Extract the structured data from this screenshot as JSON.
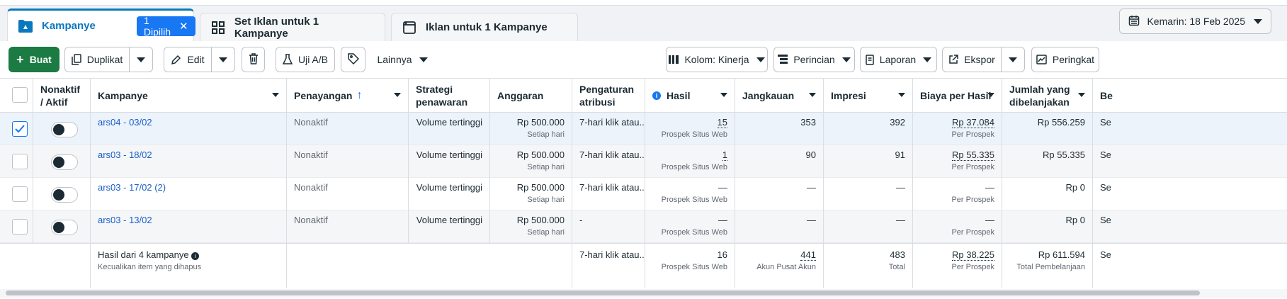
{
  "tabs": {
    "campaigns": {
      "label": "Kampanye",
      "selected_badge": "1 Dipilih"
    },
    "adsets": {
      "label": "Set Iklan untuk 1 Kampanye"
    },
    "ads": {
      "label": "Iklan untuk 1 Kampanye"
    }
  },
  "date_range": {
    "label": "Kemarin: 18 Feb 2025"
  },
  "toolbar": {
    "create": "Buat",
    "duplicate": "Duplikat",
    "edit": "Edit",
    "ab_test": "Uji A/B",
    "more": "Lainnya",
    "columns": "Kolom: Kinerja",
    "breakdown": "Perincian",
    "reports": "Laporan",
    "export": "Ekspor",
    "rules": "Peringkat"
  },
  "columns": {
    "onoff": "Nonaktif / Aktif",
    "campaign": "Kampanye",
    "delivery": "Penayangan",
    "bid_strategy": "Strategi penawaran",
    "budget": "Anggaran",
    "attribution": "Pengaturan atribusi",
    "results": "Hasil",
    "reach": "Jangkauan",
    "impressions": "Impresi",
    "cost_per_result": "Biaya per Hasil",
    "amount_spent": "Jumlah yang dibelanjakan",
    "next": "Be"
  },
  "rows": [
    {
      "name": "ars04 - 03/02",
      "delivery": "Nonaktif",
      "bid": "Volume tertinggi",
      "budget": "Rp 500.000",
      "budget_sub": "Setiap hari",
      "attribution": "7-hari klik atau...",
      "results": "15",
      "results_sub": "Prospek Situs Web",
      "reach": "353",
      "impressions": "392",
      "cpr": "Rp 37.084",
      "cpr_sub": "Per Prospek",
      "spent": "Rp 556.259",
      "next": "Se"
    },
    {
      "name": "ars03 - 18/02",
      "delivery": "Nonaktif",
      "bid": "Volume tertinggi",
      "budget": "Rp 500.000",
      "budget_sub": "Setiap hari",
      "attribution": "7-hari klik atau...",
      "results": "1",
      "results_sub": "Prospek Situs Web",
      "reach": "90",
      "impressions": "91",
      "cpr": "Rp 55.335",
      "cpr_sub": "Per Prospek",
      "spent": "Rp 55.335",
      "next": "Se"
    },
    {
      "name": "ars03 - 17/02 (2)",
      "delivery": "Nonaktif",
      "bid": "Volume tertinggi",
      "budget": "Rp 500.000",
      "budget_sub": "Setiap hari",
      "attribution": "7-hari klik atau...",
      "results": "—",
      "results_sub": "Prospek Situs Web",
      "reach": "—",
      "impressions": "—",
      "cpr": "—",
      "cpr_sub": "Per Prospek",
      "spent": "Rp 0",
      "next": "Se"
    },
    {
      "name": "ars03 - 13/02",
      "delivery": "Nonaktif",
      "bid": "Volume tertinggi",
      "budget": "Rp 500.000",
      "budget_sub": "Setiap hari",
      "attribution": "-",
      "results": "—",
      "results_sub": "Prospek Situs Web",
      "reach": "—",
      "impressions": "—",
      "cpr": "—",
      "cpr_sub": "Per Prospek",
      "spent": "Rp 0",
      "next": "Se"
    }
  ],
  "summary": {
    "title": "Hasil dari 4 kampanye",
    "subtitle": "Kecualikan item yang dihapus",
    "attribution": "7-hari klik atau...",
    "results": "16",
    "results_sub": "Prospek Situs Web",
    "reach": "441",
    "reach_sub": "Akun Pusat Akun",
    "impressions": "483",
    "impressions_sub": "Total",
    "cpr": "Rp 38.225",
    "cpr_sub": "Per Prospek",
    "spent": "Rp 611.594",
    "spent_sub": "Total Pembelanjaan",
    "next": "Se"
  }
}
